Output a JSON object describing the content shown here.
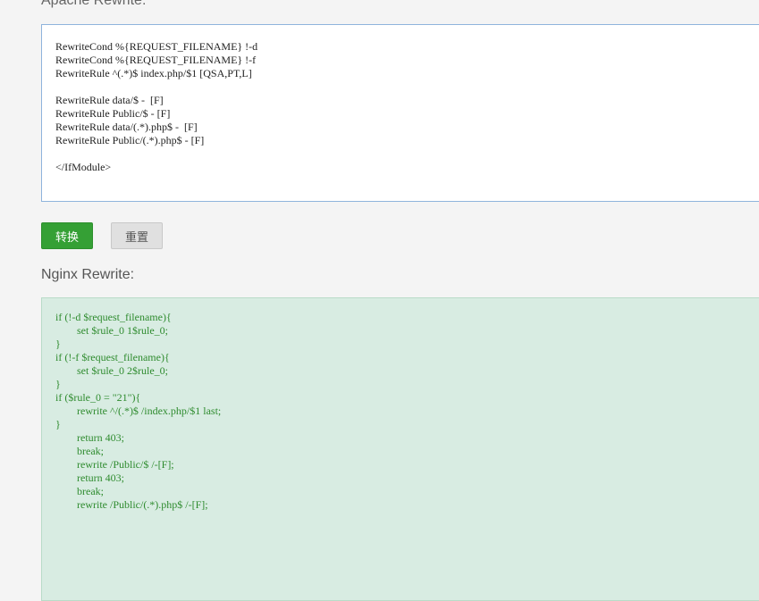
{
  "apache": {
    "label": "Apache Rewrite:",
    "code": "RewriteCond %{REQUEST_FILENAME} !-d\nRewriteCond %{REQUEST_FILENAME} !-f\nRewriteRule ^(.*)$ index.php/$1 [QSA,PT,L]\n\nRewriteRule data/$ -  [F]\nRewriteRule Public/$ - [F]\nRewriteRule data/(.*).php$ -  [F]\nRewriteRule Public/(.*).php$ - [F]\n\n</IfModule>"
  },
  "buttons": {
    "convert": "转换",
    "reset": "重置"
  },
  "nginx": {
    "label": "Nginx Rewrite:",
    "code": "if (!-d $request_filename){\n\tset $rule_0 1$rule_0;\n}\nif (!-f $request_filename){\n\tset $rule_0 2$rule_0;\n}\nif ($rule_0 = \"21\"){\n\trewrite ^/(.*)$ /index.php/$1 last;\n}\n\treturn 403;\n\tbreak;\n\trewrite /Public/$ /-[F];\n\treturn 403;\n\tbreak;\n\trewrite /Public/(.*).php$ /-[F];"
  },
  "colors": {
    "convert_button": "#35a035",
    "nginx_background": "#d8ece2",
    "nginx_text": "#2e8b2e"
  }
}
